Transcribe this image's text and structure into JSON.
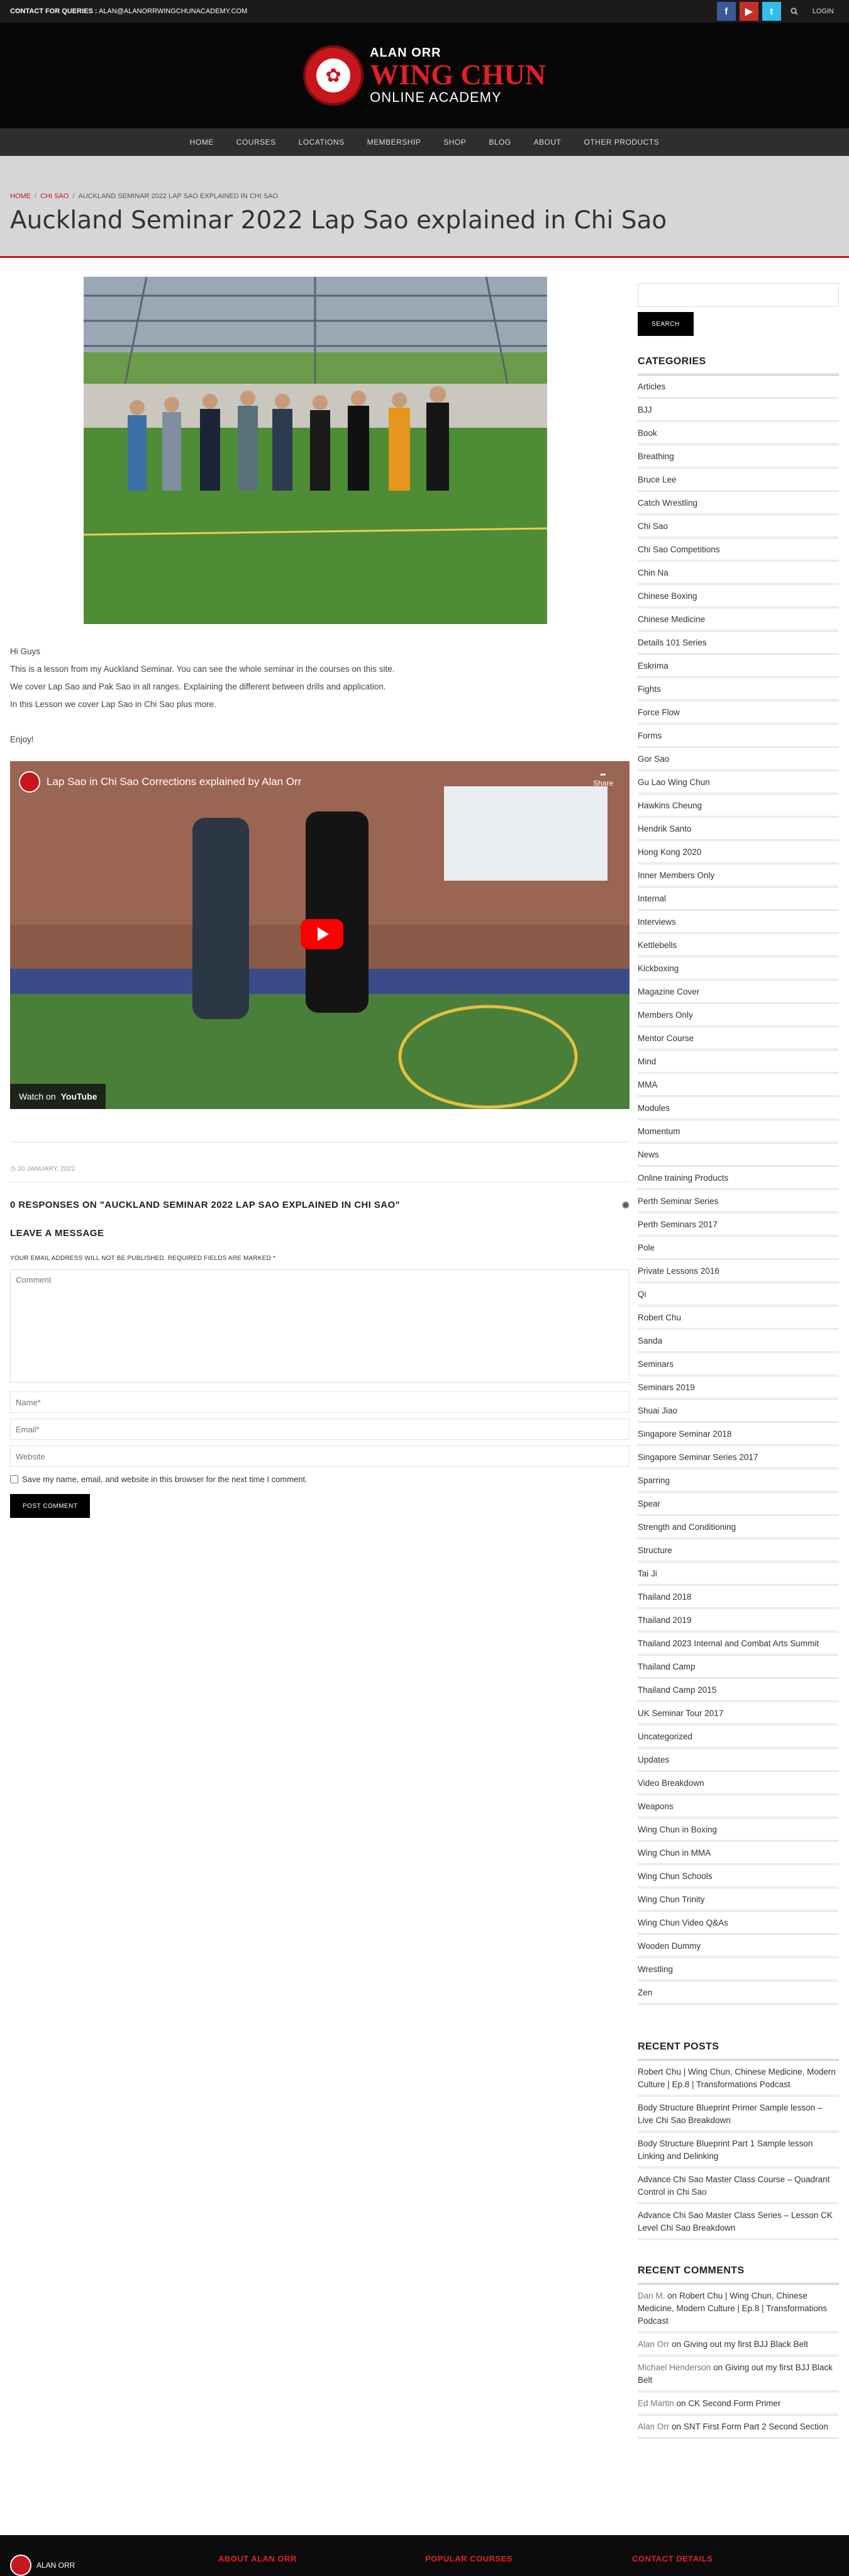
{
  "topbar": {
    "contact_label": "CONTACT FOR QUERIES :",
    "contact_email": "ALAN@ALANORRWINGCHUNACADEMY.COM",
    "login": "LOGIN",
    "social": [
      "f",
      "▶",
      "t"
    ]
  },
  "logo": {
    "line1": "ALAN ORR",
    "line2": "WING CHUN",
    "line3": "ONLINE ACADEMY"
  },
  "nav": [
    "HOME",
    "COURSES",
    "LOCATIONS",
    "MEMBERSHIP",
    "SHOP",
    "BLOG",
    "ABOUT",
    "OTHER PRODUCTS"
  ],
  "breadcrumb": {
    "home": "HOME",
    "cat": "CHI SAO",
    "current": "AUCKLAND SEMINAR 2022 LAP SAO EXPLAINED IN CHI SAO"
  },
  "page_title": "Auckland Seminar 2022 Lap Sao explained in Chi Sao",
  "post": {
    "paragraphs": [
      "Hi Guys",
      "This is a lesson from my Auckland Seminar. You can see the whole seminar in the courses on this site.",
      "We cover Lap Sao and Pak Sao in all ranges. Explaining the different between drills and application.",
      "In this Lesson we cover Lap Sao in Chi Sao plus more."
    ],
    "enjoy": "Enjoy!",
    "video_title": "Lap Sao in Chi Sao Corrections explained by Alan Orr",
    "share": "Share",
    "watch_on": "Watch on",
    "youtube": "YouTube",
    "date": "10 JANUARY, 2022"
  },
  "comments": {
    "responses": "0 RESPONSES ON \"AUCKLAND SEMINAR 2022 LAP SAO EXPLAINED IN CHI SAO\"",
    "leave": "LEAVE A MESSAGE",
    "note": "YOUR EMAIL ADDRESS WILL NOT BE PUBLISHED. REQUIRED FIELDS ARE MARKED *",
    "comment_ph": "Comment",
    "name_ph": "Name*",
    "email_ph": "Email*",
    "website_ph": "Website",
    "save": "Save my name, email, and website in this browser for the next time I comment.",
    "submit": "POST COMMENT"
  },
  "sidebar": {
    "search_btn": "SEARCH",
    "categories_title": "CATEGORIES",
    "categories": [
      "Articles",
      "BJJ",
      "Book",
      "Breathing",
      "Bruce Lee",
      "Catch Wrestling",
      "Chi Sao",
      "Chi Sao Competitions",
      "Chin Na",
      "Chinese Boxing",
      "Chinese Medicine",
      "Details 101 Series",
      "Eskrima",
      "Fights",
      "Force Flow",
      "Forms",
      "Gor Sao",
      "Gu Lao Wing Chun",
      "Hawkins Cheung",
      "Hendrik Santo",
      "Hong Kong 2020",
      "Inner Members Only",
      "Internal",
      "Interviews",
      "Kettlebells",
      "Kickboxing",
      "Magazine Cover",
      "Members Only",
      "Mentor Course",
      "Mind",
      "MMA",
      "Modules",
      "Momentum",
      "News",
      "Online training Products",
      "Perth Seminar Series",
      "Perth Seminars 2017",
      "Pole",
      "Private Lessons 2016",
      "Qi",
      "Robert Chu",
      "Sanda",
      "Seminars",
      "Seminars 2019",
      "Shuai Jiao",
      "Singapore Seminar 2018",
      "Singapore Seminar Series 2017",
      "Sparring",
      "Spear",
      "Strength and Conditioning",
      "Structure",
      "Tai Ji",
      "Thailand 2018",
      "Thailand 2019",
      "Thailand 2023 Internal and Combat Arts Summit",
      "Thailand Camp",
      "Thailand Camp 2015",
      "UK Seminar Tour 2017",
      "Uncategorized",
      "Updates",
      "Video Breakdown",
      "Weapons",
      "Wing Chun in Boxing",
      "Wing Chun in MMA",
      "Wing Chun Schools",
      "Wing Chun Trinity",
      "Wing Chun Video Q&As",
      "Wooden Dummy",
      "Wrestling",
      "Zen"
    ],
    "recent_posts_title": "RECENT POSTS",
    "recent_posts": [
      "Robert Chu | Wing Chun, Chinese Medicine, Modern Culture | Ep.8 | Transformations Podcast",
      "Body Structure Blueprint Primer Sample lesson – Live Chi Sao Breakdown",
      "Body Structure Blueprint Part 1 Sample lesson Linking and Delinking",
      "Advance Chi Sao Master Class Course – Quadrant Control in Chi Sao",
      "Advance Chi Sao Master Class Series – Lesson CK Level Chi Sao Breakdown"
    ],
    "recent_comments_title": "RECENT COMMENTS",
    "recent_comments": [
      {
        "who": "Dan M.",
        "on": "on",
        "post": "Robert Chu | Wing Chun, Chinese Medicine, Modern Culture | Ep.8 | Transformations Podcast"
      },
      {
        "who": "Alan Orr",
        "on": "on",
        "post": "Giving out my first BJJ Black Belt"
      },
      {
        "who": "Michael Henderson",
        "on": "on",
        "post": "Giving out my first BJJ Black Belt"
      },
      {
        "who": "Ed Martin",
        "on": "on",
        "post": "CK Second Form Primer"
      },
      {
        "who": "Alan Orr",
        "on": "on",
        "post": "SNT First Form Part 2 Second Section"
      }
    ]
  },
  "footer": {
    "logo_text": "ALAN ORR",
    "col1": "ABOUT ALAN ORR",
    "col2": "POPULAR COURSES",
    "col3": "CONTACT DETAILS"
  },
  "colors": {
    "accent": "#c8161d",
    "dark": "#1b1b1b"
  }
}
